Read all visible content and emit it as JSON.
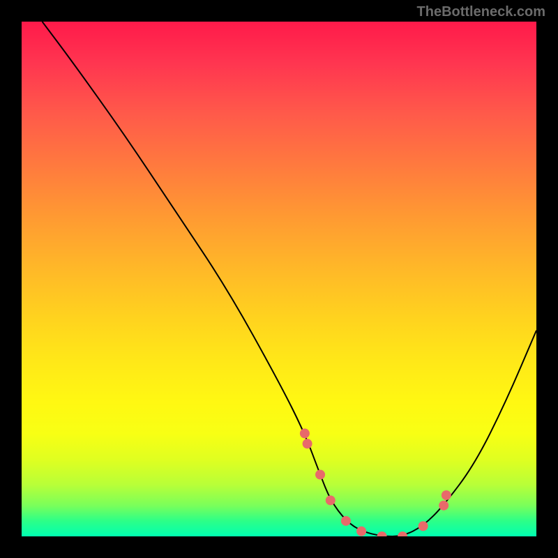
{
  "watermark": "TheBottleneck.com",
  "chart_data": {
    "type": "line",
    "title": "",
    "xlabel": "",
    "ylabel": "",
    "xlim": [
      0,
      100
    ],
    "ylim": [
      0,
      100
    ],
    "gradient_colors": [
      "#ff1a4a",
      "#ffe818",
      "#00ffb0"
    ],
    "curve": {
      "x": [
        4,
        10,
        20,
        30,
        40,
        50,
        55,
        58,
        60,
        63,
        66,
        70,
        74,
        78,
        82,
        88,
        94,
        100
      ],
      "y": [
        100,
        92,
        78,
        63,
        48,
        30,
        20,
        12,
        7,
        3,
        1,
        0,
        0,
        2,
        6,
        14,
        26,
        40
      ]
    },
    "points": {
      "x": [
        55,
        55.5,
        58,
        60,
        63,
        66,
        70,
        74,
        78,
        82,
        82.5
      ],
      "y": [
        20,
        18,
        12,
        7,
        3,
        1,
        0,
        0,
        2,
        6,
        8
      ],
      "color": "#e86a6a"
    }
  }
}
